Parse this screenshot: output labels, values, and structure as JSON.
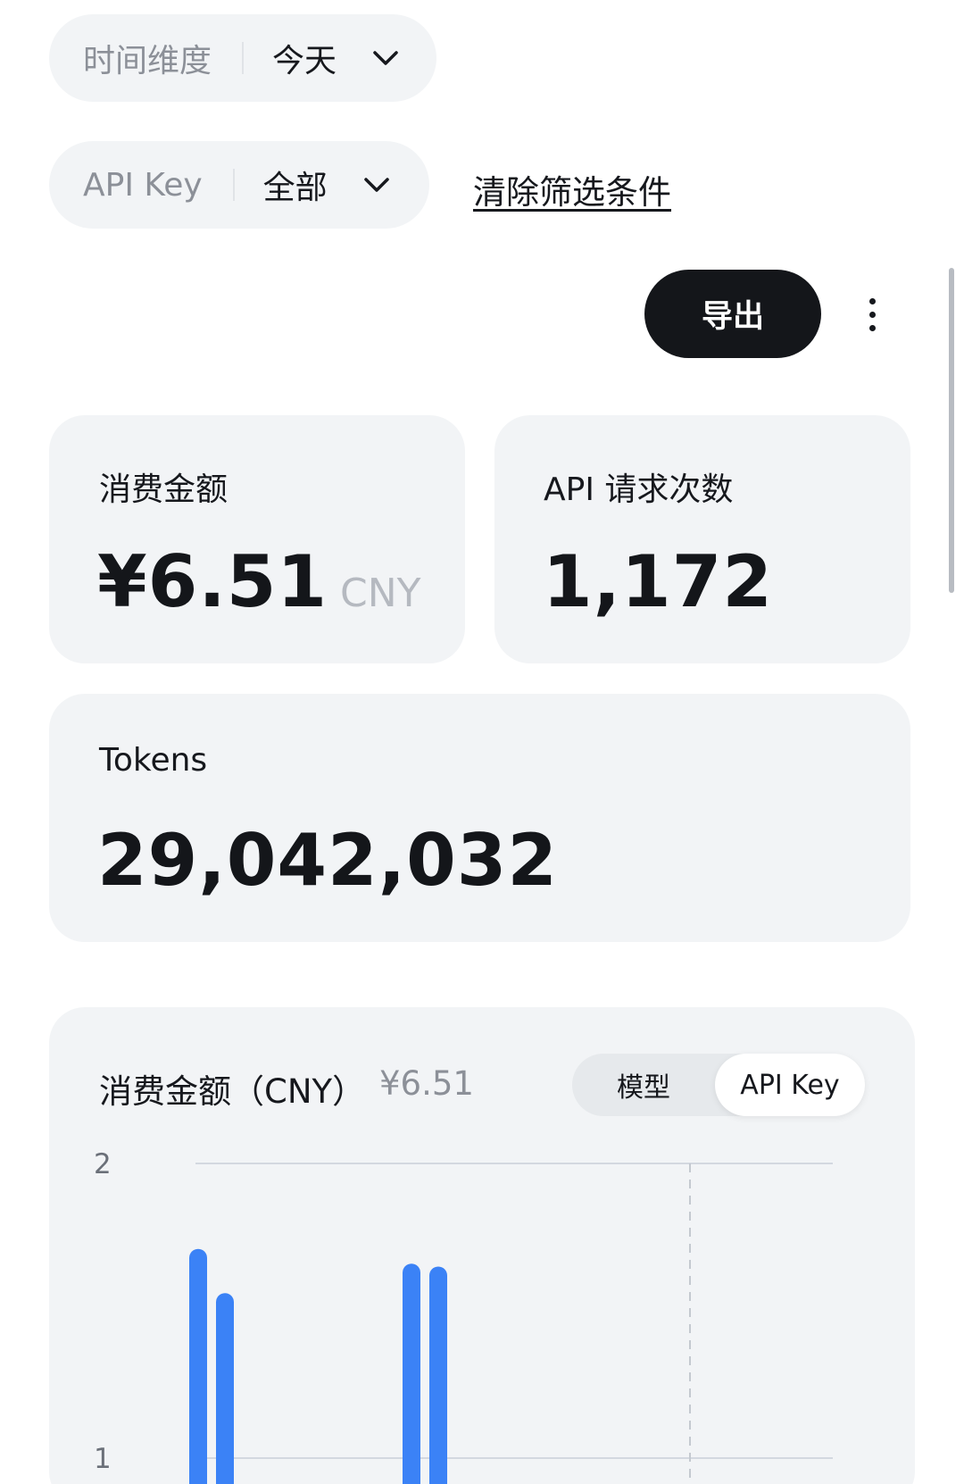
{
  "filters": {
    "time": {
      "label": "时间维度",
      "value": "今天"
    },
    "apikey": {
      "label": "API Key",
      "value": "全部"
    },
    "clear_label": "清除筛选条件"
  },
  "toolbar": {
    "export_label": "导出",
    "more_icon": "more-vertical-icon"
  },
  "stats": {
    "spend": {
      "title": "消费金额",
      "value": "¥6.51",
      "unit": "CNY"
    },
    "requests": {
      "title": "API 请求次数",
      "value": "1,172"
    },
    "tokens": {
      "title": "Tokens",
      "value": "29,042,032"
    }
  },
  "chart_panel": {
    "title": "消费金额（CNY）",
    "total": "¥6.51",
    "toggle": {
      "options": [
        "模型",
        "API Key"
      ],
      "selected": "API Key"
    }
  },
  "colors": {
    "accent": "#3b82f6",
    "export_bg": "#14161a",
    "card_bg": "#f2f4f6"
  },
  "chart_data": {
    "type": "bar",
    "title": "消费金额（CNY）",
    "y_ticks": [
      "2",
      "1"
    ],
    "ylim": [
      0,
      2
    ],
    "grid": true,
    "series": [
      {
        "values": [
          1.71,
          1.56,
          1.66,
          1.65
        ]
      }
    ],
    "bar_groups": [
      [
        0,
        1
      ],
      [
        2,
        3
      ]
    ],
    "color": "#3b82f6"
  }
}
